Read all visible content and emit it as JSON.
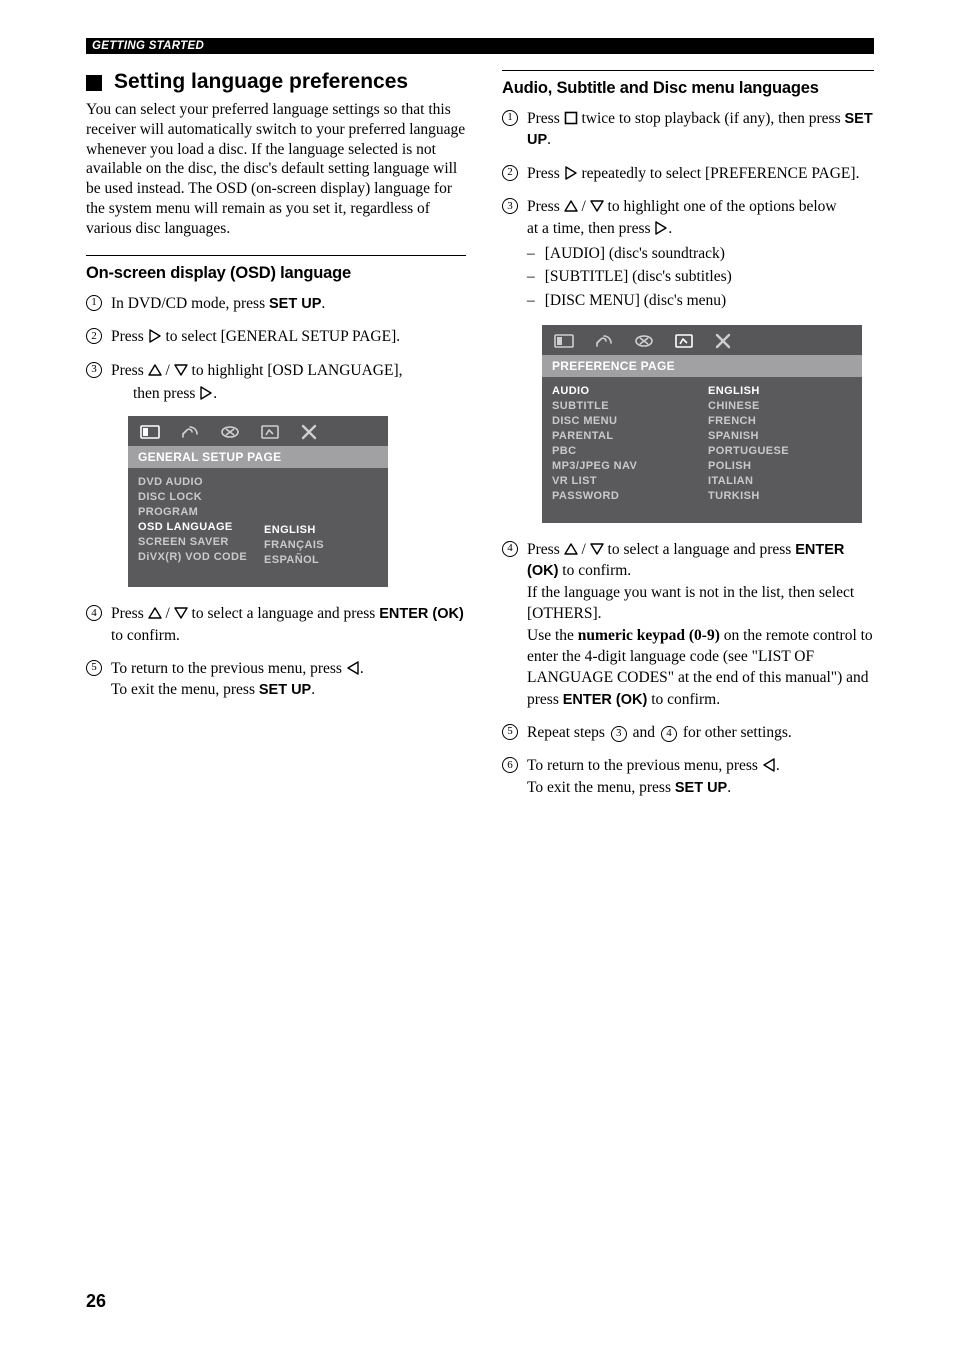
{
  "header_tag": "GETTING STARTED",
  "section_title": "Setting language preferences",
  "intro": "You can select your preferred language settings so that this receiver will automatically switch to your preferred language whenever you load a disc. If the language selected is not available on the disc, the disc's default setting language will be used instead. The OSD (on-screen display) language for the system menu will remain as you set it, regardless of various disc languages.",
  "left": {
    "heading": "On-screen display (OSD) language",
    "steps": {
      "s1_a": "In DVD/CD mode, press ",
      "s1_b": "SET UP",
      "s1_c": ".",
      "s2_a": "Press ",
      "s2_b": " to select [GENERAL SETUP PAGE].",
      "s3_a": "Press ",
      "s3_b": " to highlight [OSD LANGUAGE],",
      "s3_c": "then press ",
      "s3_d": ".",
      "s4_a": "Press ",
      "s4_b": " to select a language and press ",
      "s4_c": "ENTER (OK)",
      "s4_d": " to confirm.",
      "s5_a": "To return to the previous menu, press ",
      "s5_b": ".",
      "s5_c": "To exit the menu, press ",
      "s5_d": "SET UP",
      "s5_e": "."
    },
    "osd": {
      "title": "GENERAL SETUP PAGE",
      "left_items": [
        "DVD AUDIO",
        "DISC LOCK",
        "PROGRAM",
        "OSD LANGUAGE",
        "SCREEN SAVER",
        "DiVX(R) VOD CODE"
      ],
      "right_items": [
        "ENGLISH",
        "FRANÇAIS",
        "ESPAÑOL"
      ],
      "hl_left_index": 3,
      "hl_right_index": 0
    }
  },
  "right": {
    "heading": "Audio, Subtitle and Disc menu languages",
    "steps": {
      "s1_a": "Press ",
      "s1_b": " twice to stop playback (if any), then press ",
      "s1_c": "SET UP",
      "s1_d": ".",
      "s2_a": "Press ",
      "s2_b": " repeatedly to select [PREFERENCE PAGE].",
      "s3_a": "Press ",
      "s3_b": " to highlight one of the options below",
      "s3_c": "at a time, then press ",
      "s3_d": ".",
      "s3_opts": [
        "[AUDIO] (disc's soundtrack)",
        "[SUBTITLE] (disc's subtitles)",
        "[DISC MENU] (disc's menu)"
      ],
      "s4_a": "Press ",
      "s4_b": " to select a language and press ",
      "s4_c": "ENTER (OK)",
      "s4_d": " to confirm.",
      "s4_e": "If the language you want is not in the list, then select [OTHERS].",
      "s4_f1": "Use the ",
      "s4_f2": "numeric keypad (0-9)",
      "s4_f3": " on the remote control to enter the 4-digit language code (see \"LIST OF LANGUAGE CODES\" at the end of this manual\") and press ",
      "s4_f4": "ENTER (OK)",
      "s4_f5": " to confirm.",
      "s5_a": "Repeat steps ",
      "s5_b": " and ",
      "s5_c": " for other settings.",
      "s6_a": "To return to the previous menu, press ",
      "s6_b": ".",
      "s6_c": "To exit the menu, press ",
      "s6_d": "SET UP",
      "s6_e": "."
    },
    "osd": {
      "title": "PREFERENCE PAGE",
      "left_items": [
        "AUDIO",
        "SUBTITLE",
        "DISC MENU",
        "PARENTAL",
        "PBC",
        "MP3/JPEG NAV",
        "VR LIST",
        "PASSWORD"
      ],
      "right_items": [
        "ENGLISH",
        "CHINESE",
        "FRENCH",
        "SPANISH",
        "PORTUGUESE",
        "POLISH",
        "ITALIAN",
        "TURKISH"
      ],
      "hl_left_index": 0,
      "hl_right_index": 0
    }
  },
  "page_number": "26"
}
